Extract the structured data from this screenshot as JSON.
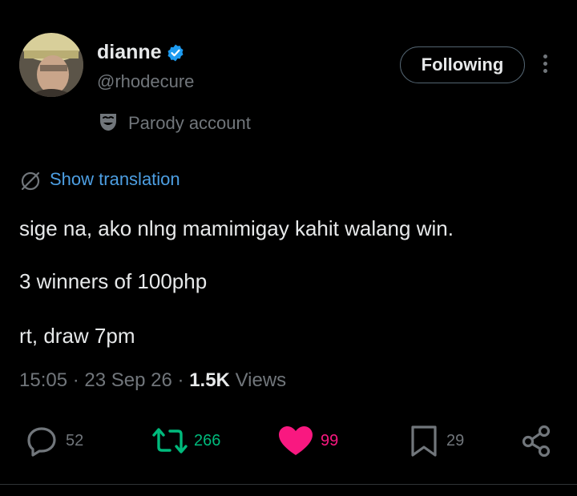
{
  "author": {
    "display_name": "dianne",
    "handle": "@rhodecure",
    "label": "Parody account"
  },
  "follow_button_label": "Following",
  "translation_link": "Show translation",
  "tweet_lines": [
    "sige na, ako nlng mamimigay kahit walang win.",
    "3 winners of 100php",
    "rt, draw 7pm"
  ],
  "meta": {
    "time": "15:05",
    "separator1": "·",
    "date": "23 Sep 26",
    "separator2": "·",
    "views_count": "1.5K",
    "views_label": "Views"
  },
  "actions": {
    "replies": "52",
    "reposts": "266",
    "likes": "99",
    "bookmarks": "29"
  },
  "colors": {
    "background": "#000000",
    "verified": "#1d9bf0",
    "link": "#4d9fe3",
    "repost": "#00ba7c",
    "like": "#f91880",
    "muted": "#71767b"
  },
  "icons": [
    "verified-badge-icon",
    "more-icon",
    "parody-mask-icon",
    "translate-globe-icon",
    "reply-icon",
    "repost-icon",
    "like-heart-icon",
    "bookmark-icon",
    "share-icon"
  ]
}
